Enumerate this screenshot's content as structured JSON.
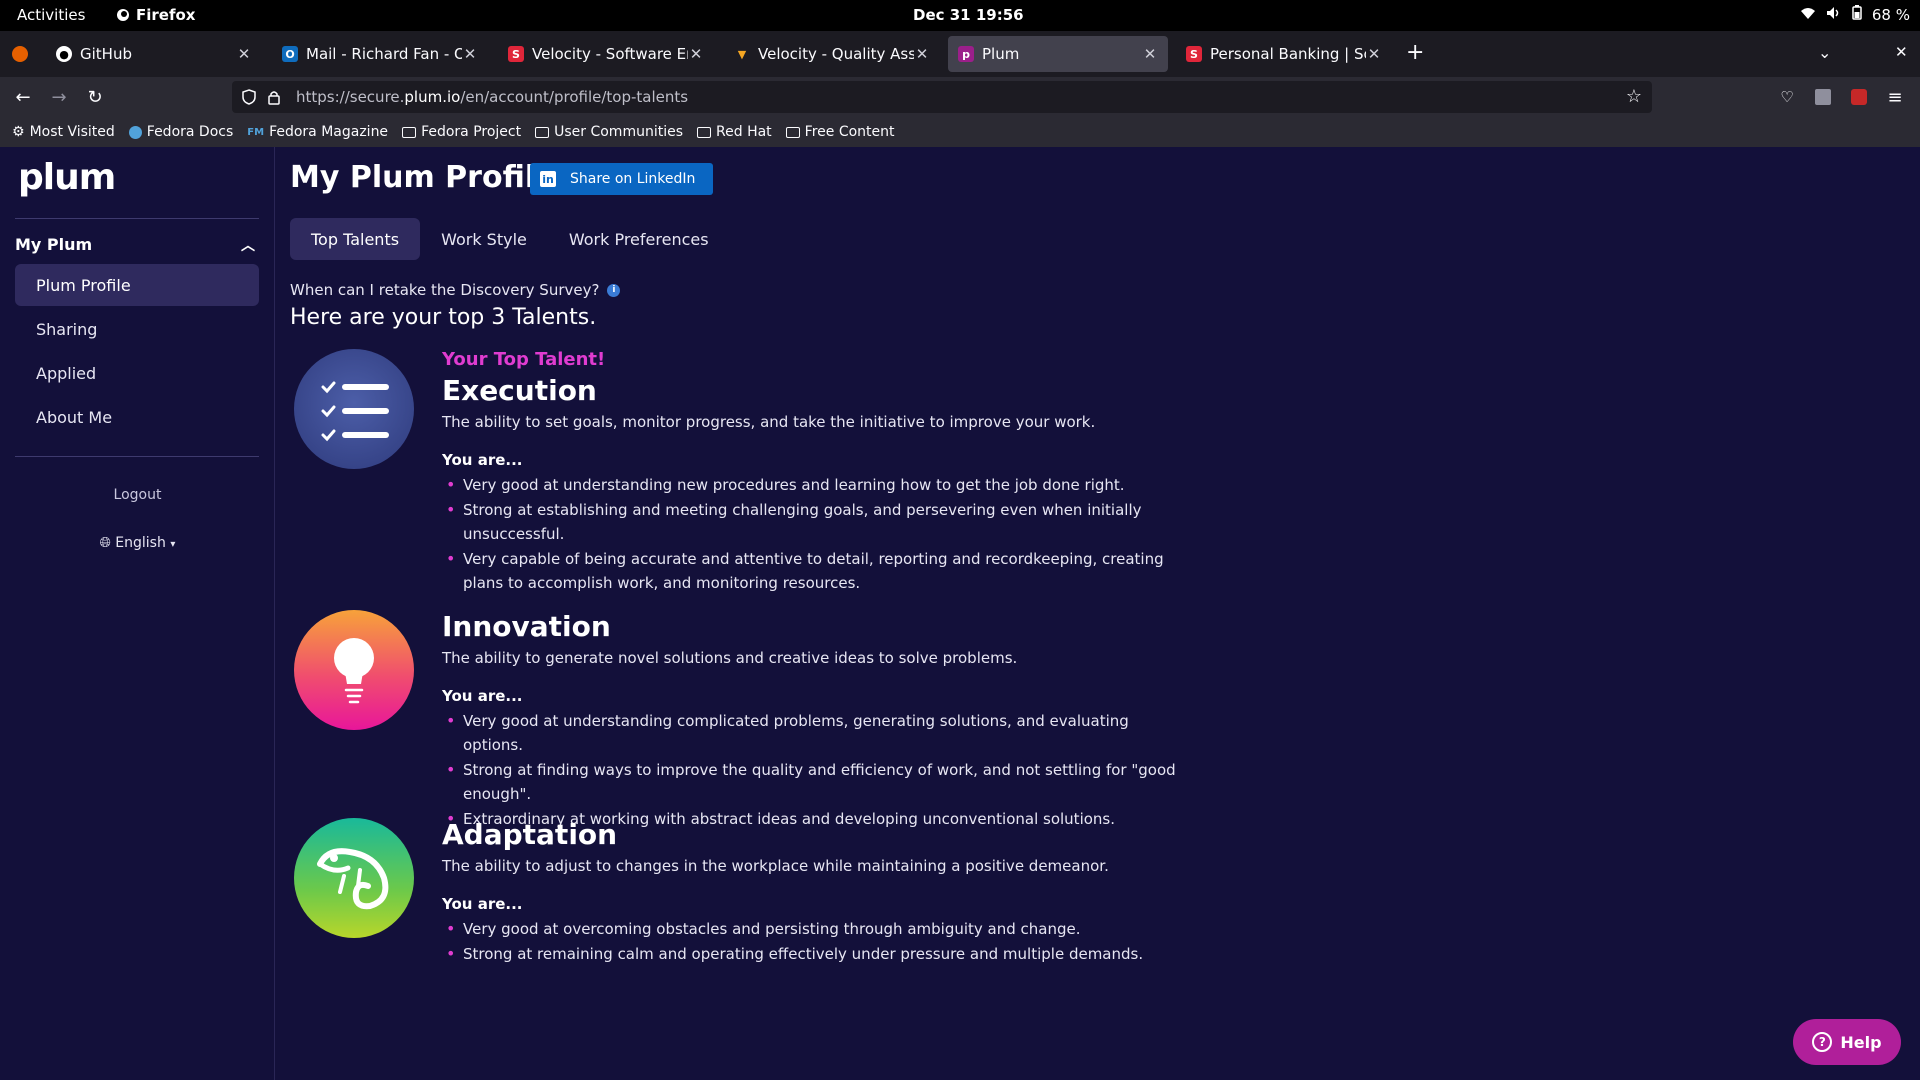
{
  "system": {
    "activities": "Activities",
    "app_name": "Firefox",
    "clock": "Dec 31  19:56",
    "battery": "68 %"
  },
  "browser": {
    "tabs": [
      {
        "title": "GitHub",
        "favicon": "github-icon",
        "active": false
      },
      {
        "title": "Mail - Richard Fan - Outlook",
        "favicon": "outlook-icon",
        "active": false
      },
      {
        "title": "Velocity - Software Engineer",
        "favicon": "velocity-icon",
        "active": false
      },
      {
        "title": "Velocity - Quality Assurance",
        "favicon": "velocity-v-icon",
        "active": false
      },
      {
        "title": "Plum",
        "favicon": "plum-icon",
        "active": true
      },
      {
        "title": "Personal Banking | Scotiabank",
        "favicon": "scotia-icon",
        "active": false
      }
    ],
    "url_prefix": "https://secure.",
    "url_domain": "plum.io",
    "url_path": "/en/account/profile/top-talents",
    "bookmarks": [
      {
        "label": "Most Visited",
        "icon": "gear-icon"
      },
      {
        "label": "Fedora Docs",
        "icon": "fedora-icon"
      },
      {
        "label": "Fedora Magazine",
        "icon": "fm-icon"
      },
      {
        "label": "Fedora Project",
        "icon": "folder-icon"
      },
      {
        "label": "User Communities",
        "icon": "folder-icon"
      },
      {
        "label": "Red Hat",
        "icon": "folder-icon"
      },
      {
        "label": "Free Content",
        "icon": "folder-icon"
      }
    ]
  },
  "sidebar": {
    "logo": "plum",
    "section": "My Plum",
    "items": [
      {
        "label": "Plum Profile",
        "active": true
      },
      {
        "label": "Sharing",
        "active": false
      },
      {
        "label": "Applied",
        "active": false
      },
      {
        "label": "About Me",
        "active": false
      }
    ],
    "logout": "Logout",
    "language": "English"
  },
  "main": {
    "title": "My Plum Profile",
    "linkedin_label": "Share on LinkedIn",
    "tabs": [
      {
        "label": "Top Talents",
        "active": true
      },
      {
        "label": "Work Style",
        "active": false
      },
      {
        "label": "Work Preferences",
        "active": false
      }
    ],
    "retake": "When can I retake the Discovery Survey?",
    "top3": "Here are your top 3 Talents.",
    "top_talent_label": "Your Top Talent!",
    "you_are": "You are...",
    "talents": [
      {
        "name": "Execution",
        "icon": "checklist-icon",
        "description": "The ability to set goals, monitor progress, and take the initiative to improve your work.",
        "points": [
          "Very good at understanding new procedures and learning how to get the job done right.",
          "Strong at establishing and meeting challenging goals, and persevering even when initially unsuccessful.",
          "Very capable of being accurate and attentive to detail, reporting and recordkeeping, creating plans to accomplish work, and monitoring resources."
        ]
      },
      {
        "name": "Innovation",
        "icon": "lightbulb-icon",
        "description": "The ability to generate novel solutions and creative ideas to solve problems.",
        "points": [
          "Very good at understanding complicated problems, generating solutions, and evaluating options.",
          "Strong at finding ways to improve the quality and efficiency of work, and not settling for \"good enough\".",
          "Extraordinary at working with abstract ideas and developing unconventional solutions."
        ]
      },
      {
        "name": "Adaptation",
        "icon": "chameleon-icon",
        "description": "The ability to adjust to changes in the workplace while maintaining a positive demeanor.",
        "points": [
          "Very good at overcoming obstacles and persisting through ambiguity and change.",
          "Strong at remaining calm and operating effectively under pressure and multiple demands."
        ]
      }
    ],
    "help": "Help"
  },
  "colors": {
    "page_bg": "#13103a",
    "accent_magenta": "#e03cd0",
    "linkedin_blue": "#0a66c2",
    "help_bg": "#b01f9a"
  }
}
